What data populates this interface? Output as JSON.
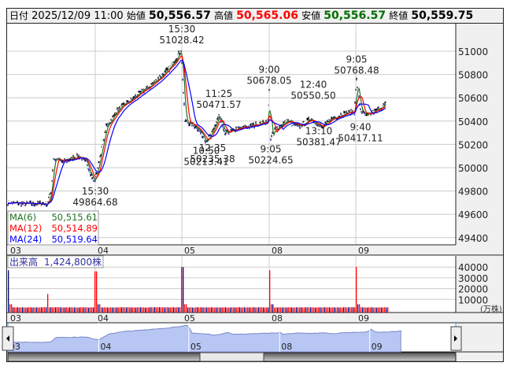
{
  "header": {
    "date_label": "日付",
    "datetime": "2025/12/09 11:00",
    "open_label": "始値",
    "open": "50,556.57",
    "high_label": "高値",
    "high": "50,565.06",
    "low_label": "安値",
    "low": "50,556.57",
    "close_label": "終値",
    "close": "50,559.75"
  },
  "colors": {
    "high": "#ff0000",
    "low": "#007000",
    "ma6": "#207020",
    "ma12": "#ff0000",
    "ma24": "#0000ff",
    "candle_down": "#000080",
    "candle_up": "#000000",
    "nav_fill": "#b8c6f4"
  },
  "price_axis": {
    "ticks": [
      "51000",
      "50800",
      "50600",
      "50400",
      "50200",
      "50000",
      "49800",
      "49600",
      "49400"
    ]
  },
  "date_ticks": [
    "03",
    "04",
    "05",
    "08",
    "09"
  ],
  "ma_legend": [
    {
      "label": "MA(6)",
      "value": "50,515.61"
    },
    {
      "label": "MA(12)",
      "value": "50,514.89"
    },
    {
      "label": "MA(24)",
      "value": "50,519.64"
    }
  ],
  "annotations": [
    {
      "time": "15:30",
      "price": "51028.42",
      "pos": "above"
    },
    {
      "time": "15:30",
      "price": "49864.68",
      "pos": "below"
    },
    {
      "time": "11:25",
      "price": "50471.57",
      "pos": "above"
    },
    {
      "time": "10:50",
      "price": "50213.41",
      "pos": "below"
    },
    {
      "time": "12:35",
      "price": "50235.38",
      "pos": "below"
    },
    {
      "time": "9:00",
      "price": "50678.05",
      "pos": "above"
    },
    {
      "time": "9:05",
      "price": "50224.65",
      "pos": "below"
    },
    {
      "time": "12:40",
      "price": "50550.50",
      "pos": "above"
    },
    {
      "time": "13:10",
      "price": "50381.47",
      "pos": "below"
    },
    {
      "time": "9:05",
      "price": "50768.48",
      "pos": "above"
    },
    {
      "time": "9:40",
      "price": "50417.11",
      "pos": "below"
    }
  ],
  "volume": {
    "label": "出来高",
    "value": "1,424,800株",
    "ticks": [
      "40000",
      "30000",
      "20000",
      "10000"
    ],
    "unit": "(万株)"
  }
}
